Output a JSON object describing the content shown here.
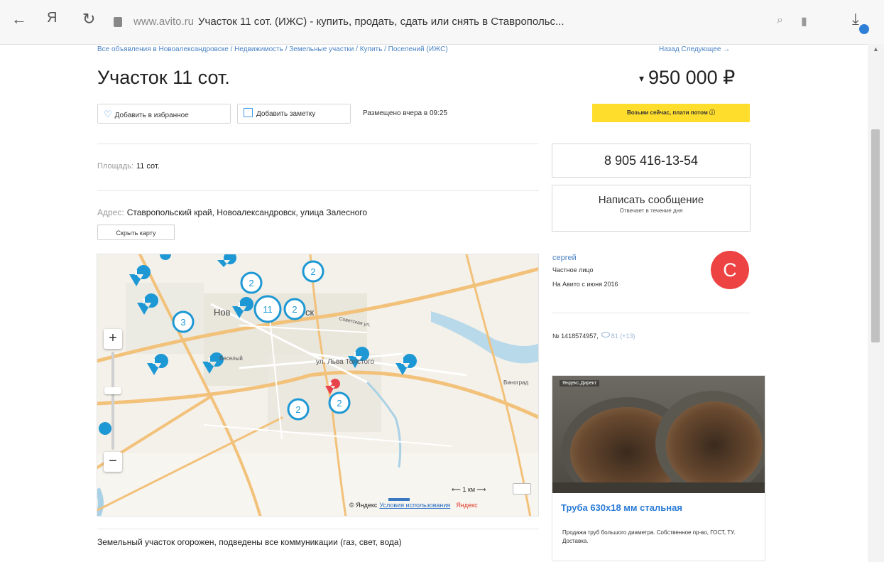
{
  "browser": {
    "back_icon": "←",
    "yandex_icon": "Я",
    "reload_icon": "↻",
    "domain": "www.avito.ru",
    "page_title": "Участок 11 сот. (ИЖС) - купить, продать, сдать или снять в Ставропольс...",
    "search_icon": "⌕",
    "bookmark_icon": "▮",
    "download_icon": "⤓"
  },
  "breadcrumb": "Все объявления в Новоалександровске / Недвижимость / Земельные участки / Купить / Поселений (ИЖС)",
  "nav_links": "Назад   Следующее →",
  "listing": {
    "title": "Участок 11 сот.",
    "price_caret": "▾",
    "price": "950 000 ₽",
    "add_favorite": "Добавить в избранное",
    "add_note": "Добавить заметку",
    "posted": "Размещено вчера в 09:25",
    "buy_now": "Возьми сейчас, плати потом   ⓘ",
    "area_label": "Площадь:",
    "area_value": "11 сот.",
    "address_label": "Адрес:",
    "address_value": "Ставропольский край, Новоалександровск, улица Залесного",
    "hide_map": "Скрыть карту",
    "description": "Земельный участок огорожен, подведены все коммуникации (газ, свет, вода)"
  },
  "map": {
    "zoom_plus": "+",
    "zoom_minus": "−",
    "scale": "⟵ 1 км ⟶",
    "copyright": "© Яндекс",
    "terms": "Условия использования",
    "ylogo": "Яндекс",
    "city_label": "Нов",
    "city_label_2": "ск",
    "street_1": "ул. Льва Толстого",
    "street_2": "Советская ул.",
    "place_1": "Веселый",
    "place_2": "Виноград",
    "clusters": [
      "2",
      "2",
      "11",
      "2",
      "3",
      "2",
      "2"
    ],
    "pin_label": "1"
  },
  "contact": {
    "phone": "8 905 416-13-54",
    "message_title": "Написать сообщение",
    "message_sub": "Отвечает в течение дня",
    "seller_name": "сергей",
    "seller_type": "Частное лицо",
    "seller_since": "На Авито с июня 2016",
    "avatar_letter": "С",
    "ad_number": "№ 1418574957,",
    "views": "81 (+13)"
  },
  "promo": {
    "tag": "Яндекс.Директ",
    "title": "Труба 630х18 мм стальная",
    "text": "Продажа труб большого диаметра. Собственное пр-во, ГОСТ, ТУ. Доставка."
  },
  "colors": {
    "link": "#4a82c4",
    "yellow_button": "#ffdd2d",
    "avatar": "#ed4343",
    "map_marker": "#1e98d4"
  }
}
